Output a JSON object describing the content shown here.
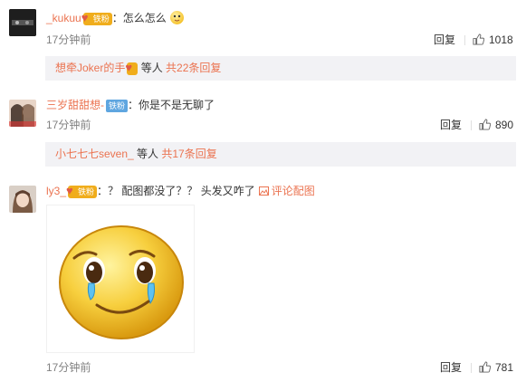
{
  "comments": [
    {
      "username": "_kukuu",
      "badge": "铁粉",
      "text": "：怎么怎么",
      "time": "17分钟前",
      "reply_label": "回复",
      "likes": "1018",
      "sub": {
        "user": "想牵Joker的手",
        "middle": " 等人 ",
        "count_text": "共22条回复"
      }
    },
    {
      "username": "三岁甜甜想-",
      "badge": "铁粉",
      "text": "：你是不是无聊了",
      "time": "17分钟前",
      "reply_label": "回复",
      "likes": "890",
      "sub": {
        "user": "小七七七seven_",
        "middle": " 等人 ",
        "count_text": "共17条回复"
      }
    },
    {
      "username": "ly3_",
      "badge": "铁粉",
      "text": "：？ 配图都没了？？ 头发又咋了",
      "pic_label": "评论配图",
      "time": "17分钟前",
      "reply_label": "回复",
      "likes": "781"
    }
  ],
  "colors": {
    "link": "#eb7350",
    "gold_badge": "#f0ad1c",
    "blue_badge": "#5fa6e0",
    "sub_bg": "#f2f2f5"
  },
  "icons": [
    "thumb-up-icon",
    "picture-icon",
    "crying-emoji"
  ]
}
